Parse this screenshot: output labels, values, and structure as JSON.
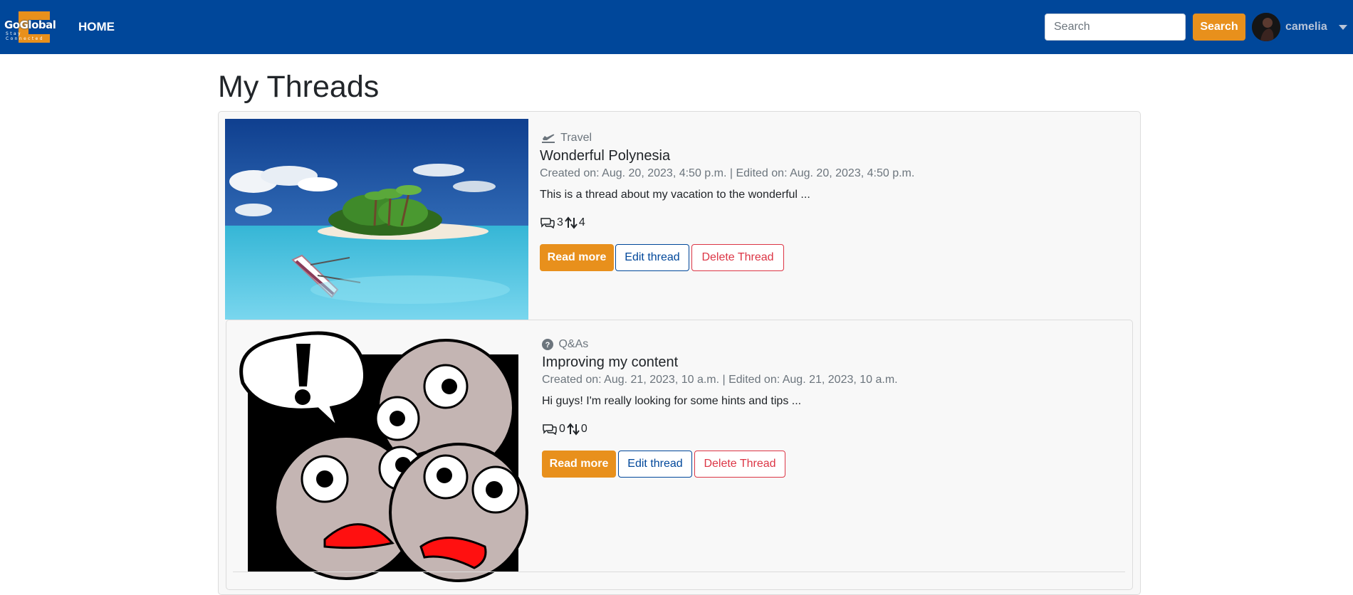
{
  "navbar": {
    "logo_text": "GoGlobal",
    "logo_subtext": "Stay Connected",
    "home_label": "HOME",
    "search_placeholder": "Search",
    "search_button": "Search",
    "username": "camelia"
  },
  "page": {
    "title": "My Threads"
  },
  "threads": [
    {
      "category": "Travel",
      "category_icon": "plane-departure-icon",
      "title": "Wonderful Polynesia",
      "dates": "Created on: Aug. 20, 2023, 4:50 p.m. | Edited on: Aug. 20, 2023, 4:50 p.m.",
      "excerpt": "This is a thread about my vacation to the wonderful ...",
      "comments": "3",
      "votes": "4",
      "read_more": "Read more",
      "edit": "Edit thread",
      "delete": "Delete Thread"
    },
    {
      "category": "Q&As",
      "category_icon": "question-circle-icon",
      "title": "Improving my content",
      "dates": "Created on: Aug. 21, 2023, 10 a.m. | Edited on: Aug. 21, 2023, 10 a.m.",
      "excerpt": "Hi guys! I'm really looking for some hints and tips ...",
      "comments": "0",
      "votes": "0",
      "read_more": "Read more",
      "edit": "Edit thread",
      "delete": "Delete Thread"
    }
  ],
  "colors": {
    "navbar": "#00479a",
    "accent": "#e8901c",
    "danger": "#dc3545"
  }
}
